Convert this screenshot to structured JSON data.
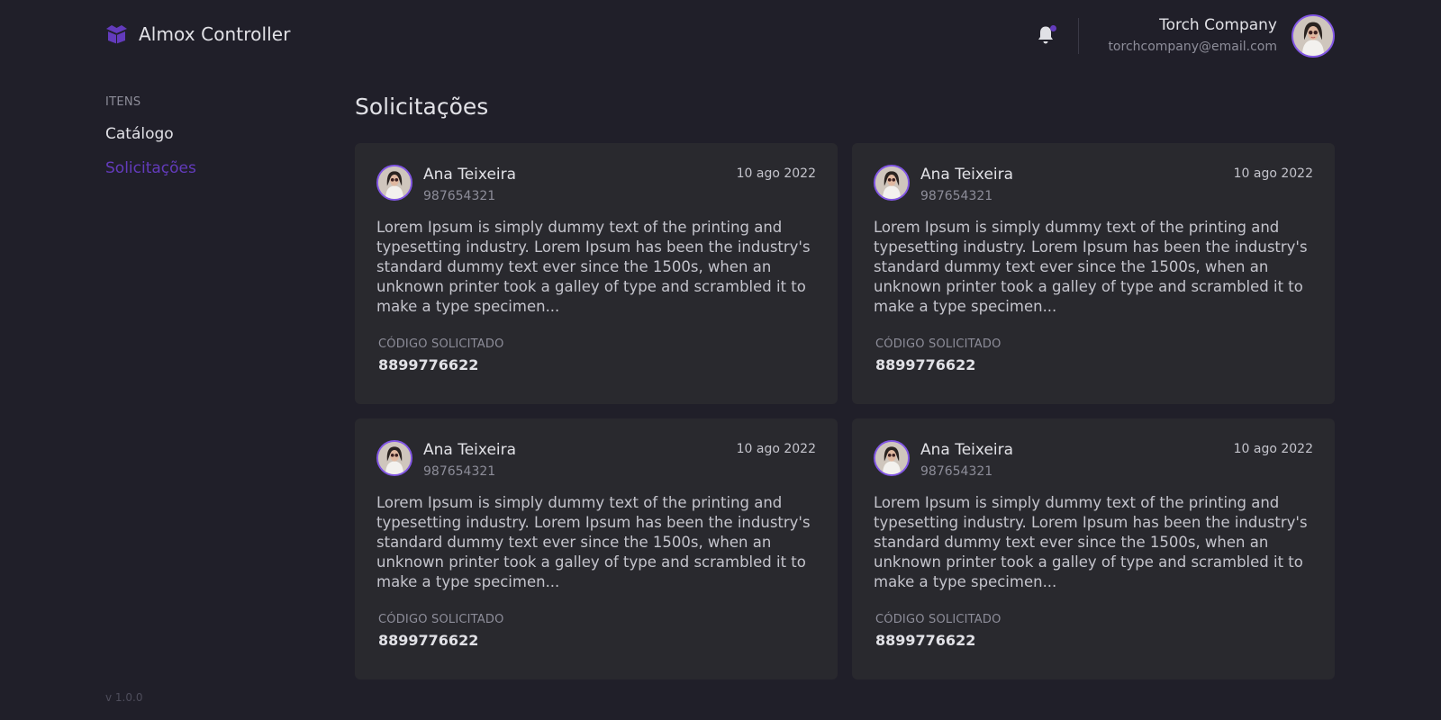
{
  "app": {
    "title": "Almox Controller",
    "version": "v 1.0.0"
  },
  "header": {
    "user": {
      "name": "Torch Company",
      "email": "torchcompany@email.com"
    },
    "notifications": {
      "has_unread": true
    }
  },
  "sidebar": {
    "section_label": "ITENS",
    "items": [
      {
        "label": "Catálogo",
        "active": false
      },
      {
        "label": "Solicitações",
        "active": true
      }
    ]
  },
  "main": {
    "title": "Solicitações",
    "cards": [
      {
        "name": "Ana Teixeira",
        "id": "987654321",
        "date": "10 ago 2022",
        "text": "Lorem Ipsum is simply dummy text of the printing and typesetting industry. Lorem Ipsum has been the industry's standard dummy text ever since the 1500s, when an unknown printer took a galley of type and scrambled it to make a type specimen...",
        "code_label": "CÓDIGO SOLICITADO",
        "code": "8899776622"
      },
      {
        "name": "Ana Teixeira",
        "id": "987654321",
        "date": "10 ago 2022",
        "text": "Lorem Ipsum is simply dummy text of the printing and typesetting industry. Lorem Ipsum has been the industry's standard dummy text ever since the 1500s, when an unknown printer took a galley of type and scrambled it to make a type specimen...",
        "code_label": "CÓDIGO SOLICITADO",
        "code": "8899776622"
      },
      {
        "name": "Ana Teixeira",
        "id": "987654321",
        "date": "10 ago 2022",
        "text": "Lorem Ipsum is simply dummy text of the printing and typesetting industry. Lorem Ipsum has been the industry's standard dummy text ever since the 1500s, when an unknown printer took a galley of type and scrambled it to make a type specimen...",
        "code_label": "CÓDIGO SOLICITADO",
        "code": "8899776622"
      },
      {
        "name": "Ana Teixeira",
        "id": "987654321",
        "date": "10 ago 2022",
        "text": "Lorem Ipsum is simply dummy text of the printing and typesetting industry. Lorem Ipsum has been the industry's standard dummy text ever since the 1500s, when an unknown printer took a galley of type and scrambled it to make a type specimen...",
        "code_label": "CÓDIGO SOLICITADO",
        "code": "8899776622"
      }
    ]
  },
  "colors": {
    "background": "#201f29",
    "card": "#29292e",
    "accent": "#633bbc",
    "avatar_ring": "#8257e5",
    "text": "#e1e1e6",
    "muted": "#8d8d99"
  },
  "icons": {
    "brand": "box-icon",
    "notifications": "bell-icon"
  }
}
